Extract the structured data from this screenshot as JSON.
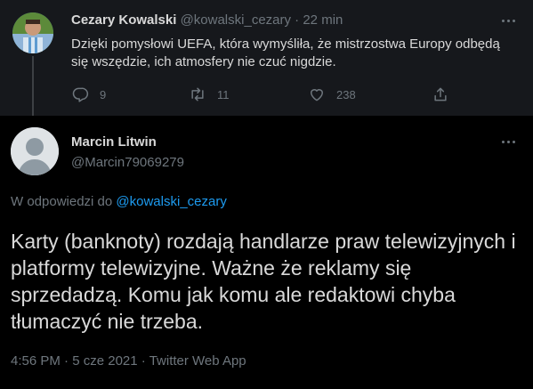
{
  "parent_tweet": {
    "author_name": "Cezary Kowalski",
    "handle": "@kowalski_cezary",
    "separator": "·",
    "time": "22 min",
    "text": "Dzięki pomysłowi UEFA, która wymyśliła, że mistrzostwa Europy odbędą się wszędzie, ich atmosfery nie czuć nigdzie.",
    "replies": "9",
    "retweets": "11",
    "likes": "238",
    "icons": [
      "reply-icon",
      "retweet-icon",
      "like-icon",
      "share-icon",
      "more-icon"
    ]
  },
  "main_tweet": {
    "author_name": "Marcin Litwin",
    "handle": "@Marcin79069279",
    "reply_prefix": "W odpowiedzi do",
    "reply_handle": "@kowalski_cezary",
    "text": "Karty (banknoty) rozdają handlarze praw telewizyjnych i platformy telewizyjne. Ważne że reklamy się sprzedadzą. Komu jak komu ale redaktowi chyba tłumaczyć nie trzeba.",
    "time": "4:56 PM",
    "date": "5 cze 2021",
    "source": "Twitter Web App",
    "separator": "·"
  },
  "colors": {
    "background": "#000000",
    "parent_background": "#16181c",
    "text": "#d9d9d9",
    "secondary": "#6e767d",
    "link": "#1d9bf0"
  }
}
